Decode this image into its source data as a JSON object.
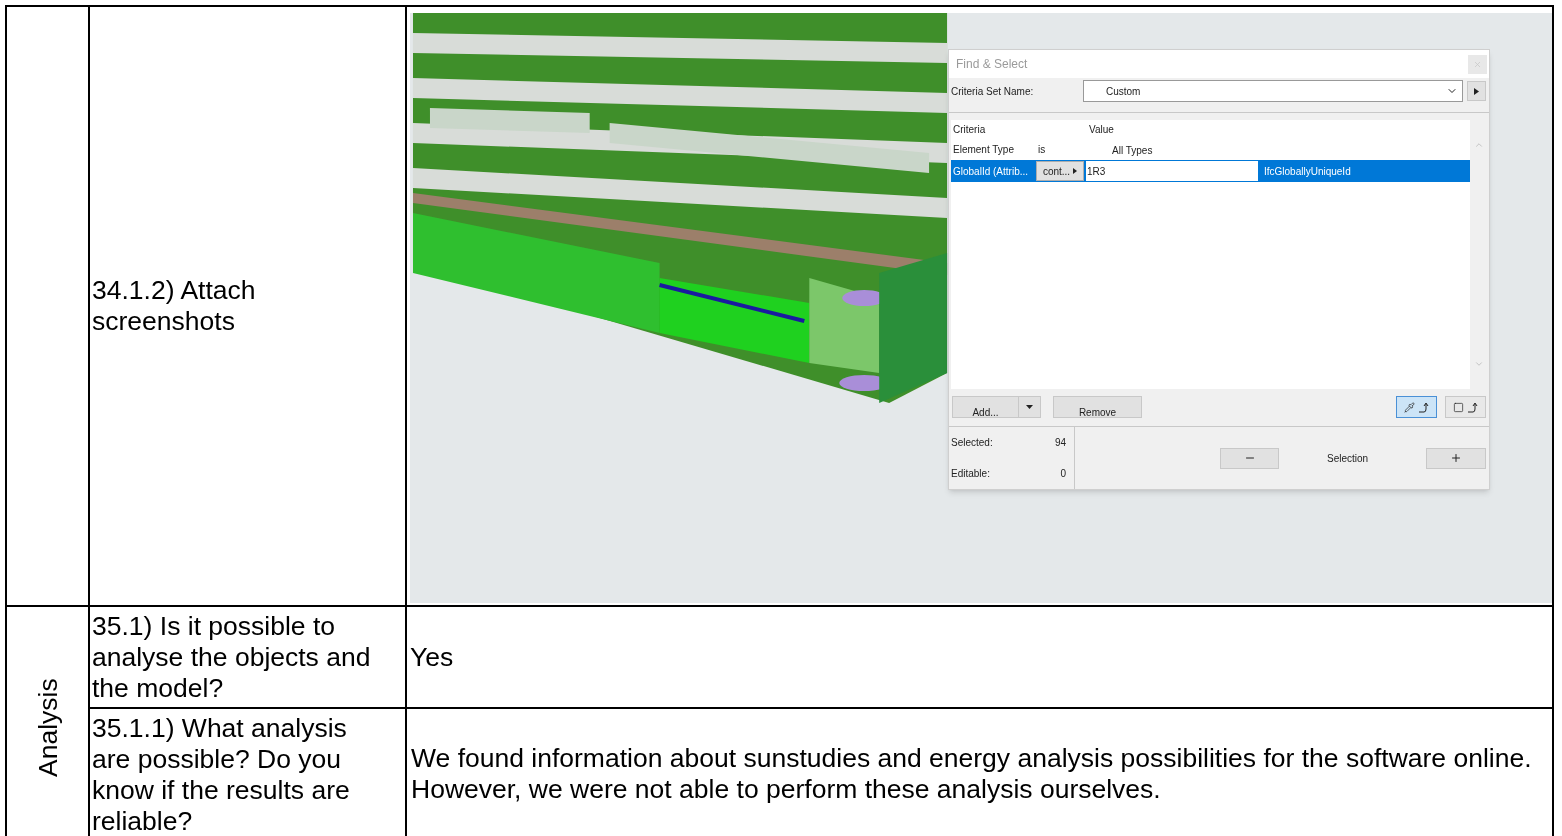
{
  "table": {
    "rows": [
      {
        "question": "34.1.2) Attach screenshots",
        "answer": {
          "kind": "screenshot"
        }
      }
    ],
    "section": {
      "label": "Analysis",
      "rows": [
        {
          "question": "35.1) Is it possible to analyse the objects and the model?",
          "answer": {
            "kind": "text",
            "text": "Yes"
          }
        },
        {
          "question": "35.1.1) What analysis are possible? Do you know if the results are reliable?",
          "answer": {
            "kind": "text",
            "text": "We found information about sunstudies and energy analysis possibilities for the software online. However, we were not able to perform these analysis ourselves."
          }
        }
      ]
    }
  },
  "dialog": {
    "title": "Find & Select",
    "criteria_set_label": "Criteria Set Name:",
    "criteria_set_value": "Custom",
    "columns": [
      "Criteria",
      "Value"
    ],
    "criteria": [
      {
        "name": "Element Type",
        "operator": "is",
        "value": "All Types",
        "selected": false
      },
      {
        "name": "GlobalId (Attrib...",
        "operator": "cont...",
        "value": "1R3",
        "type": "IfcGloballyUniqueId",
        "selected": true
      }
    ],
    "add_button": "Add...",
    "remove_button": "Remove",
    "tools": [
      {
        "kind": "pick",
        "selected": true
      },
      {
        "kind": "marquee",
        "selected": false
      }
    ],
    "stats": [
      {
        "label": "Selected:",
        "value": "94"
      },
      {
        "label": "Editable:",
        "value": "0"
      }
    ],
    "selection_label": "Selection"
  }
}
